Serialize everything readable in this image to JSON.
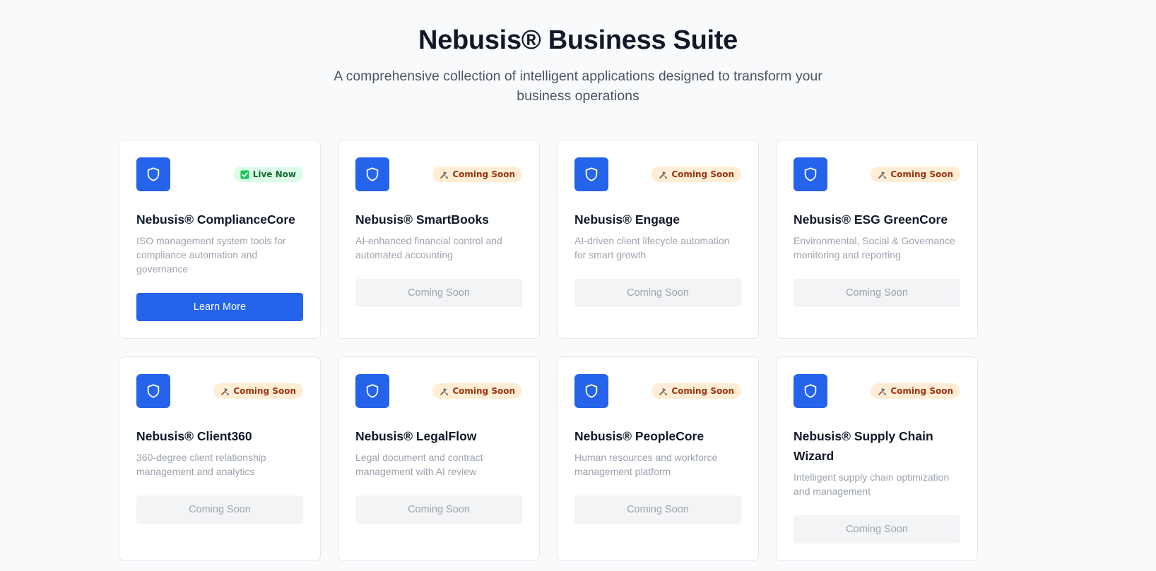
{
  "header": {
    "title": "Nebusis® Business Suite",
    "subtitle": "A comprehensive collection of intelligent applications designed to transform your business operations"
  },
  "colors": {
    "accent": "#2563eb",
    "live_badge_bg": "#dcfce7",
    "live_badge_text": "#166534",
    "soon_badge_bg": "#ffedd5",
    "soon_badge_text": "#9a3412",
    "disabled_button_bg": "#f3f4f6",
    "disabled_button_text": "#9ca3af"
  },
  "apps": [
    {
      "name": "Nebusis® ComplianceCore",
      "description": "ISO management system tools for compliance automation and governance",
      "status": "live",
      "badge_icon": "check-box-icon",
      "badge": "Live Now",
      "button": "Learn More",
      "icon": "shield-icon"
    },
    {
      "name": "Nebusis® SmartBooks",
      "description": "AI-enhanced financial control and automated accounting",
      "status": "soon",
      "badge_icon": "hammer-wrench-icon",
      "badge": "Coming Soon",
      "button": "Coming Soon",
      "icon": "shield-icon"
    },
    {
      "name": "Nebusis® Engage",
      "description": "AI-driven client lifecycle automation for smart growth",
      "status": "soon",
      "badge_icon": "hammer-wrench-icon",
      "badge": "Coming Soon",
      "button": "Coming Soon",
      "icon": "shield-icon"
    },
    {
      "name": "Nebusis® ESG GreenCore",
      "description": "Environmental, Social & Governance monitoring and reporting",
      "status": "soon",
      "badge_icon": "hammer-wrench-icon",
      "badge": "Coming Soon",
      "button": "Coming Soon",
      "icon": "shield-icon"
    },
    {
      "name": "Nebusis® Client360",
      "description": "360-degree client relationship management and analytics",
      "status": "soon",
      "badge_icon": "hammer-wrench-icon",
      "badge": "Coming Soon",
      "button": "Coming Soon",
      "icon": "shield-icon"
    },
    {
      "name": "Nebusis® LegalFlow",
      "description": "Legal document and contract management with AI review",
      "status": "soon",
      "badge_icon": "hammer-wrench-icon",
      "badge": "Coming Soon",
      "button": "Coming Soon",
      "icon": "shield-icon"
    },
    {
      "name": "Nebusis® PeopleCore",
      "description": "Human resources and workforce management platform",
      "status": "soon",
      "badge_icon": "hammer-wrench-icon",
      "badge": "Coming Soon",
      "button": "Coming Soon",
      "icon": "shield-icon"
    },
    {
      "name": "Nebusis® Supply Chain Wizard",
      "description": "Intelligent supply chain optimization and management",
      "status": "soon",
      "badge_icon": "hammer-wrench-icon",
      "badge": "Coming Soon",
      "button": "Coming Soon",
      "icon": "shield-icon"
    }
  ]
}
